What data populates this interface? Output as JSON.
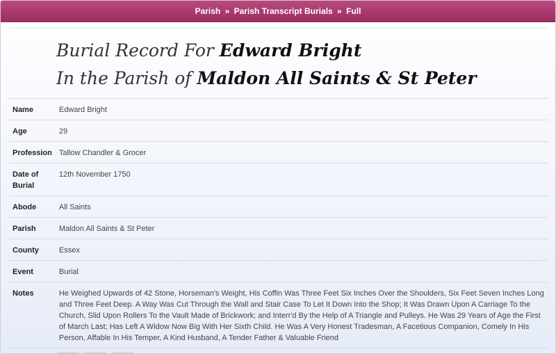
{
  "breadcrumb": {
    "items": [
      "Parish",
      "Parish Transcript Burials",
      "Full"
    ],
    "separator": "»"
  },
  "heading": {
    "line1_prefix": "Burial Record For",
    "line1_name": "Edward Bright",
    "line2_prefix": "In the Parish of",
    "line2_parish": "Maldon All Saints & St Peter"
  },
  "record": {
    "name": {
      "label": "Name",
      "value": "Edward Bright"
    },
    "age": {
      "label": "Age",
      "value": "29"
    },
    "profession": {
      "label": "Profession",
      "value": "Tallow Chandler & Grocer"
    },
    "date": {
      "label": "Date of Burial",
      "value": "12th November 1750"
    },
    "abode": {
      "label": "Abode",
      "value": "All Saints"
    },
    "parish": {
      "label": "Parish",
      "value": "Maldon All Saints & St Peter"
    },
    "county": {
      "label": "County",
      "value": "Essex"
    },
    "event": {
      "label": "Event",
      "value": "Burial"
    },
    "notes": {
      "label": "Notes",
      "value": "He Weighed Upwards of 42 Stone, Horseman's Weight, His Coffin Was Three Feet Six Inches Over the Shoulders, Six Feet Seven Inches Long and Three Feet Deep. A Way Was Cut Through the Wall and Stair Case To Let It Down Into the Shop; It Was Drawn Upon A Carriage To the Church, Slid Upon Rollers To the Vault Made of Brickwork; and Interr'd By the Help of A Triangle and Pulleys. He Was 29 Years of Age the First of March Last; Has Left A Widow Now Big With Her Sixth Child. He Was A Very Honest Tradesman, A Facetious Companion, Comely In His Person, Affable In His Temper, A Kind Husband, A Tender Father & Valuable Friend"
    }
  },
  "actions": {
    "icons": [
      "link-person-icon",
      "query-icon",
      "save-disk-icon"
    ],
    "accent": "#a3306a"
  }
}
